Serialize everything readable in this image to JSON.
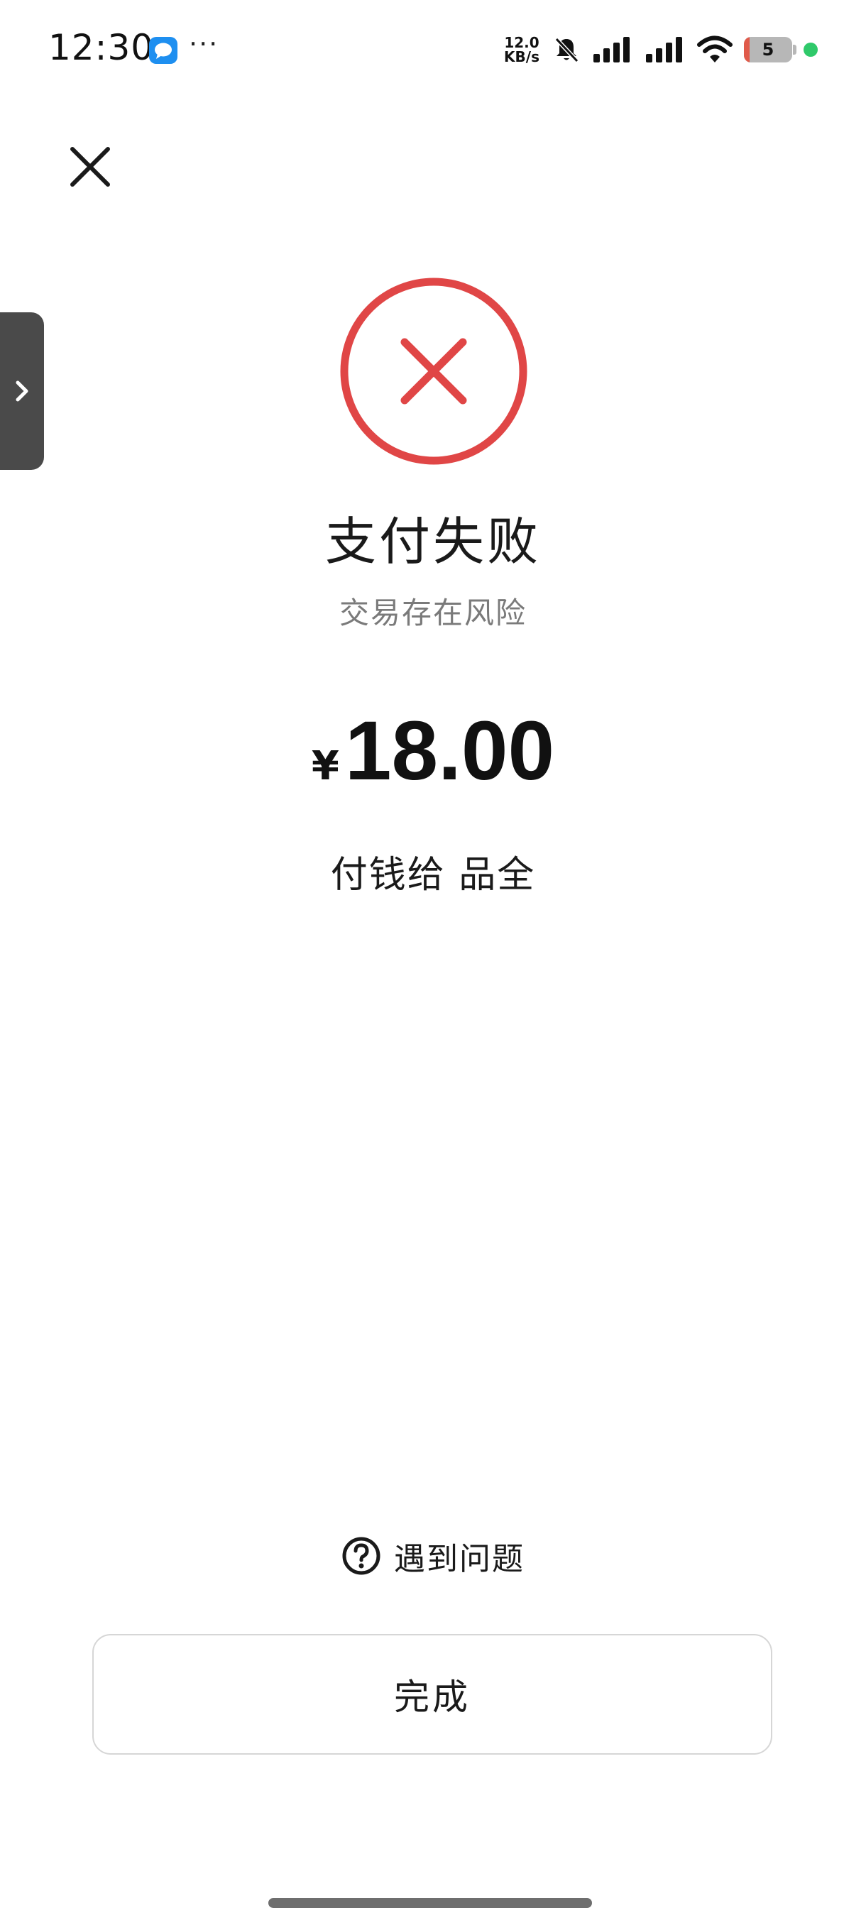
{
  "status_bar": {
    "time": "12:30",
    "more": "···",
    "net_speed_value": "12.0",
    "net_speed_unit": "KB/s",
    "battery_level": "5",
    "icons": [
      "message-icon",
      "mute-bell-icon",
      "signal-icon",
      "signal-icon",
      "wifi-icon",
      "battery-icon"
    ]
  },
  "result": {
    "title": "支付失败",
    "reason": "交易存在风险",
    "currency": "¥",
    "amount": "18.00",
    "payee": "付钱给 品全",
    "status_color": "#e04646"
  },
  "help": {
    "label": "遇到问题"
  },
  "actions": {
    "done_label": "完成"
  }
}
